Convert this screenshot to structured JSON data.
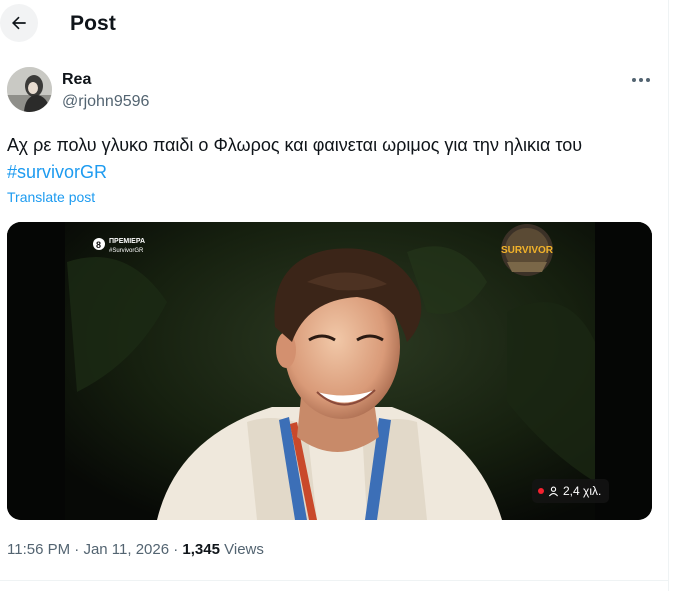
{
  "header": {
    "title": "Post",
    "back_icon": "arrow-left-icon"
  },
  "author": {
    "name": "Rea",
    "handle": "@rjohn9596",
    "avatar_icon": "avatar-photo"
  },
  "tweet": {
    "text": "Αχ ρε πολυ γλυκο παιδι ο Φλωρος και φαινεται ωριμος για την ηλικια του",
    "hashtag": "#survivorGR",
    "translate_label": "Translate post"
  },
  "media": {
    "channel_line1": "ΠΡΕΜΙΕΡΑ",
    "channel_line2": "#SurvivorGR",
    "logo_text": "SURVIVOR",
    "view_count": "2,4 χιλ.",
    "live_color": "#f4212e"
  },
  "meta": {
    "time": "11:56 PM",
    "separator": "·",
    "date": "Jan 11, 2026",
    "views_count": "1,345",
    "views_label": "Views"
  },
  "colors": {
    "accent": "#1d9bf0",
    "secondary_text": "#536471",
    "primary_text": "#0f1419"
  }
}
